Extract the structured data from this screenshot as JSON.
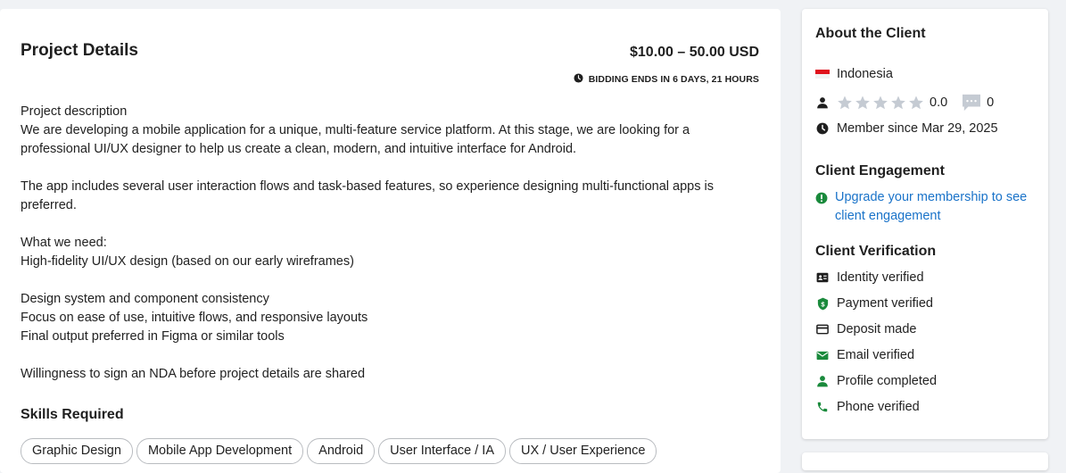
{
  "project": {
    "title": "Project Details",
    "price": "$10.00 – 50.00 USD",
    "bidding": "BIDDING ENDS IN 6 DAYS, 21 HOURS",
    "description": [
      "Project description",
      "We are developing a mobile application for a unique, multi-feature service platform. At this stage, we are looking for a",
      "professional UI/UX designer to help us create a clean, modern, and intuitive interface for Android.",
      "",
      "The app includes several user interaction flows and task-based features, so experience designing multi-functional apps is",
      "preferred.",
      "",
      "What we need:",
      "High-fidelity UI/UX design (based on our early wireframes)",
      "",
      "Design system and component consistency",
      "Focus on ease of use, intuitive flows, and responsive layouts",
      "Final output preferred in Figma or similar tools",
      "",
      "Willingness to sign an NDA before project details are shared"
    ],
    "skills_heading": "Skills Required",
    "skills": [
      "Graphic Design",
      "Mobile App Development",
      "Android",
      "User Interface / IA",
      "UX / User Experience"
    ]
  },
  "client": {
    "heading": "About the Client",
    "country": "Indonesia",
    "rating": "0.0",
    "reviews": "0",
    "member_since": "Member since Mar 29, 2025",
    "engagement_heading": "Client Engagement",
    "engagement_link": "Upgrade your membership to see client engagement",
    "verification_heading": "Client Verification",
    "verifications": [
      {
        "label": "Identity verified",
        "icon": "id-card-icon"
      },
      {
        "label": "Payment verified",
        "icon": "shield-dollar-icon"
      },
      {
        "label": "Deposit made",
        "icon": "credit-card-icon"
      },
      {
        "label": "Email verified",
        "icon": "envelope-icon"
      },
      {
        "label": "Profile completed",
        "icon": "person-icon"
      },
      {
        "label": "Phone verified",
        "icon": "phone-icon"
      }
    ]
  },
  "colors": {
    "verified_green": "#1a8a3c",
    "link_blue": "#1a73c9",
    "star_gray": "#c5cbd3"
  }
}
